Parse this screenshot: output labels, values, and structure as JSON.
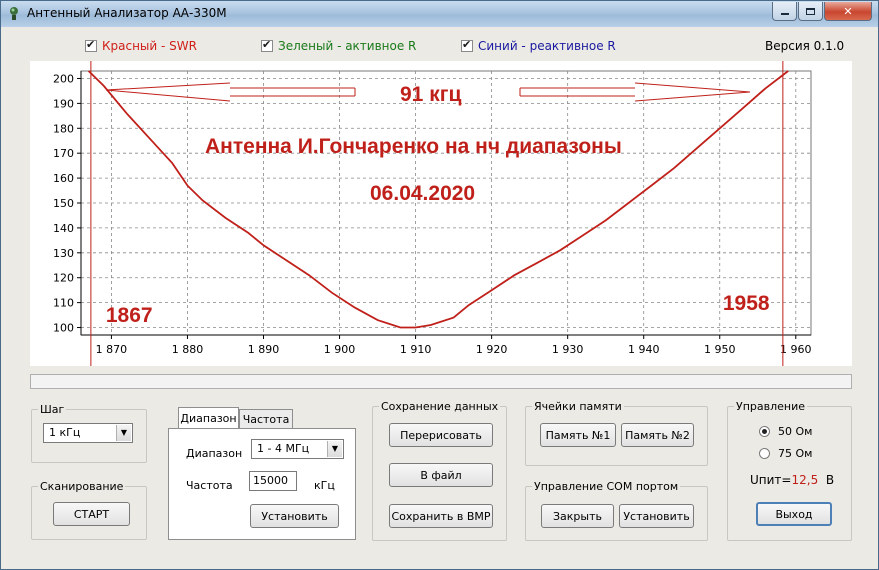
{
  "window": {
    "title": "Антенный Анализатор АА-330М"
  },
  "legend": {
    "red": {
      "label": "Красный - SWR",
      "color": "#d0201a"
    },
    "green": {
      "label": "Зеленый - активное R",
      "color": "#1a7a1a"
    },
    "blue": {
      "label": "Синий - реактивное R",
      "color": "#1a1aa0"
    }
  },
  "version": "Версия 0.1.0",
  "chart_data": {
    "type": "line",
    "xlim": [
      1866,
      1962
    ],
    "ylim": [
      97,
      203
    ],
    "x_ticks": [
      1870,
      1880,
      1890,
      1900,
      1910,
      1920,
      1930,
      1940,
      1950,
      1960
    ],
    "x_tick_labels": [
      "1 870",
      "1 880",
      "1 890",
      "1 900",
      "1 910",
      "1 920",
      "1 930",
      "1 940",
      "1 950",
      "1 960"
    ],
    "y_ticks": [
      100,
      110,
      120,
      130,
      140,
      150,
      160,
      170,
      180,
      190,
      200
    ],
    "y_tick_labels": [
      "100",
      "110",
      "120",
      "130",
      "140",
      "150",
      "160",
      "170",
      "180",
      "190",
      "200"
    ],
    "grid": true,
    "series": [
      {
        "color": "#c0201a",
        "x": [
          1867,
          1869,
          1872,
          1875,
          1878,
          1880,
          1882,
          1885,
          1888,
          1890,
          1893,
          1896,
          1899,
          1902,
          1905,
          1908,
          1910,
          1912,
          1915,
          1917,
          1920,
          1923,
          1926,
          1929,
          1932,
          1935,
          1938,
          1941,
          1944,
          1947,
          1950,
          1953,
          1956,
          1959
        ],
        "values": [
          203,
          197,
          186,
          176,
          166,
          157,
          151,
          144,
          138,
          133,
          127,
          121,
          114,
          108,
          103,
          100,
          100,
          101,
          104,
          109,
          115,
          121,
          126,
          131,
          137,
          143,
          150,
          157,
          164,
          172,
          180,
          188,
          196,
          203
        ]
      }
    ],
    "markers": [
      {
        "x": 1867.3,
        "label": "1867",
        "color": "#c0201a"
      },
      {
        "x": 1958.3,
        "label": "1958",
        "color": "#c0201a"
      }
    ],
    "annotations": {
      "bandwidth": "91 кгц",
      "title": "Антенна И.Гончаренко на нч диапазоны",
      "date": "06.04.2020"
    }
  },
  "step": {
    "legend": "Шаг",
    "value": "1 кГц"
  },
  "scan": {
    "legend": "Сканирование",
    "start": "СТАРТ"
  },
  "range_panel": {
    "tabs": [
      "Диапазон",
      "Частота"
    ],
    "range_label": "Диапазон",
    "range_value": "1 - 4 МГц",
    "freq_label": "Частота",
    "freq_value": "15000",
    "freq_unit": "кГц",
    "set_button": "Установить"
  },
  "save": {
    "legend": "Сохранение данных",
    "redraw": "Перерисовать",
    "to_file": "В файл",
    "to_bmp": "Сохранить в BMP"
  },
  "memory": {
    "legend": "Ячейки памяти",
    "mem1": "Память №1",
    "mem2": "Память №2"
  },
  "com": {
    "legend": "Управление  COM портом",
    "close": "Закрыть",
    "set": "Установить"
  },
  "control": {
    "legend": "Управление",
    "r50": "50  Ом",
    "r75": "75  Ом",
    "supply_label": "Uпит=",
    "supply_value": "12,5",
    "supply_unit": "В",
    "exit": "Выход"
  }
}
